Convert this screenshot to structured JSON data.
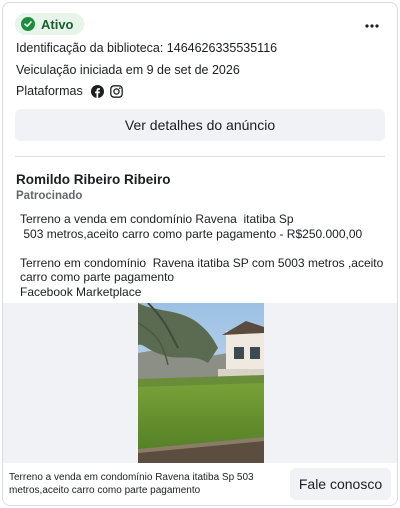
{
  "status": {
    "label": "Ativo",
    "color": "#1e8e3e"
  },
  "icons": {
    "status": "check-circle-icon",
    "more": "more-options-icon",
    "facebook": "facebook-icon",
    "instagram": "instagram-icon"
  },
  "info": {
    "library_id": "Identificação da biblioteca: 1464626335535116",
    "started": "Veiculação iniciada em 9 de set de 2026",
    "platforms_label": "Plataformas"
  },
  "details_button": "Ver detalhes do anúncio",
  "ad": {
    "advertiser": "Romildo Ribeiro Ribeiro",
    "sponsored": "Patrocinado",
    "body": "Terreno a venda em condomínio Ravena  itatiba Sp\n 503 metros,aceito carro como parte pagamento - R$250.000,00\n\nTerreno em condomínio  Ravena itatiba SP com 5003 metros ,aceito carro como parte pagamento\nFacebook Marketplace"
  },
  "footer": {
    "caption": "Terreno a venda em condomínio Ravena itatiba Sp 503 metros,aceito carro como parte pagamento",
    "cta": "Fale conosco"
  }
}
